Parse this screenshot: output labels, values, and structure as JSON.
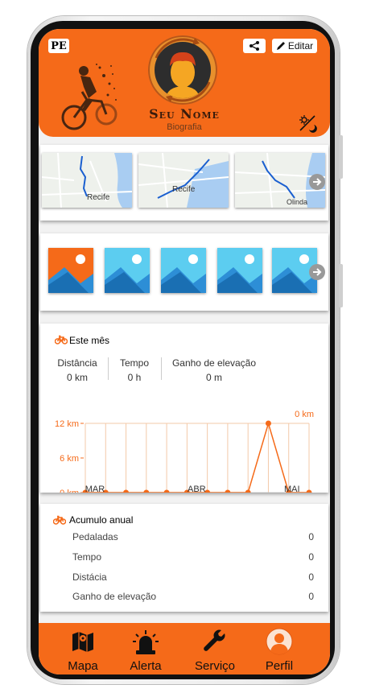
{
  "header": {
    "state_badge": "PE",
    "user_name": "Seu Nome",
    "bio": "Biografia",
    "edit_label": "Editar",
    "icons": [
      "share-icon",
      "edit-icon",
      "night-mode-icon",
      "cyclist-illustration",
      "avatar-icon"
    ],
    "accent_color": "#f56a19"
  },
  "route_maps": [
    {
      "city_label": "Recife"
    },
    {
      "city_label": "Recife"
    },
    {
      "city_label": "Olinda"
    }
  ],
  "photos": {
    "count": 5
  },
  "month_stats": {
    "title": "Este mês",
    "columns": [
      {
        "label": "Distância",
        "value": "0 km"
      },
      {
        "label": "Tempo",
        "value": "0 h"
      },
      {
        "label": "Ganho de elevação",
        "value": "0 m"
      }
    ]
  },
  "chart_data": {
    "type": "line",
    "x_tick_labels": [
      "MAR",
      "ABR",
      "MAI"
    ],
    "y_tick_labels": [
      "0 km",
      "6 km",
      "12 km"
    ],
    "ylim": [
      0,
      12
    ],
    "current_value_label": "0 km",
    "series": [
      {
        "values": [
          0,
          0,
          0,
          0,
          0,
          0,
          0,
          0,
          0,
          12,
          0,
          0
        ]
      }
    ],
    "grid": true,
    "color": "#f56a19"
  },
  "annual": {
    "title": "Acumulo anual",
    "rows": [
      {
        "label": "Pedaladas",
        "value": "0"
      },
      {
        "label": "Tempo",
        "value": "0"
      },
      {
        "label": "Distácia",
        "value": "0"
      },
      {
        "label": "Ganho de elevação",
        "value": "0"
      }
    ]
  },
  "tabbar": {
    "tabs": [
      {
        "label": "Mapa",
        "icon": "map-icon"
      },
      {
        "label": "Alerta",
        "icon": "siren-icon"
      },
      {
        "label": "Serviço",
        "icon": "wrench-icon"
      },
      {
        "label": "Perfil",
        "icon": "profile-icon"
      }
    ]
  }
}
